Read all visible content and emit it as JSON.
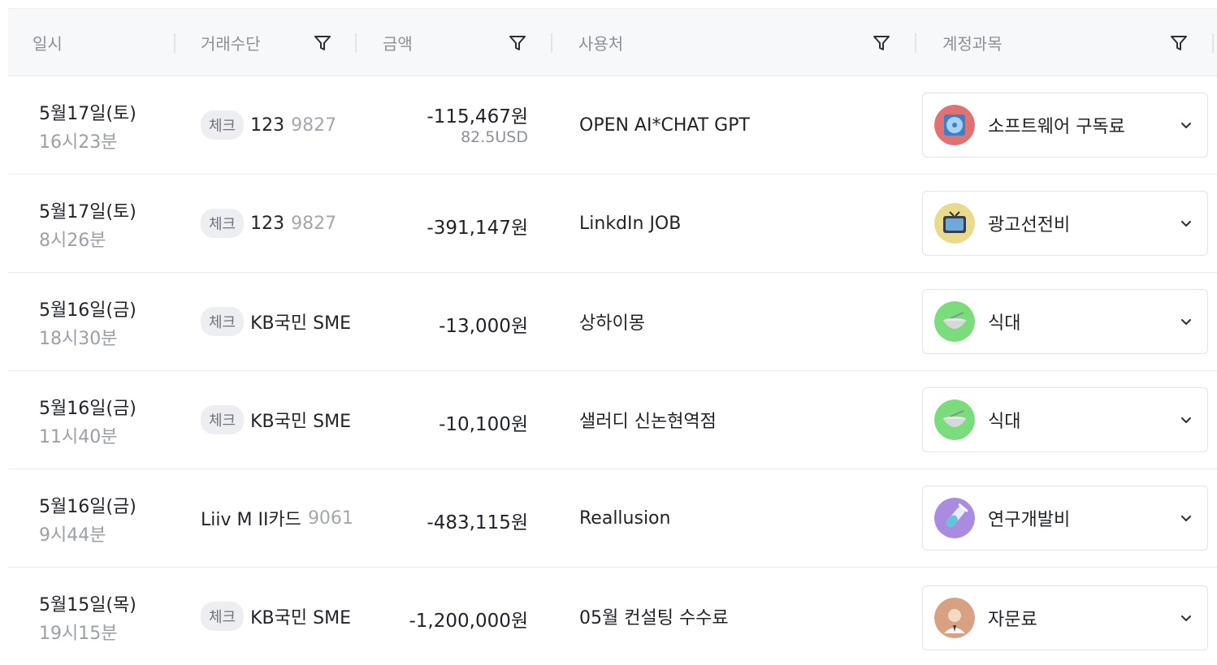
{
  "header": {
    "date": "일시",
    "method": "거래수단",
    "amount": "금액",
    "merchant": "사용처",
    "account": "계정과목"
  },
  "rows": [
    {
      "date": "5월17일(토)",
      "time": "16시23분",
      "chip": "체크",
      "card": "123",
      "cardnum": "9827",
      "amount": "-115,467원",
      "amount_sub": "82.5USD",
      "merchant": "OPEN AI*CHAT GPT",
      "account": "소프트웨어 구독료",
      "icon": "software-disc-icon",
      "icon_color": "#e07272"
    },
    {
      "date": "5월17일(토)",
      "time": "8시26분",
      "chip": "체크",
      "card": "123",
      "cardnum": "9827",
      "amount": "-391,147원",
      "merchant": "LinkdIn JOB",
      "account": "광고선전비",
      "icon": "tv-icon",
      "icon_color": "#e8dc8c"
    },
    {
      "date": "5월16일(금)",
      "time": "18시30분",
      "chip": "체크",
      "card": "KB국민 SME",
      "cardnum": "",
      "amount": "-13,000원",
      "merchant": "상하이몽",
      "account": "식대",
      "icon": "bowl-icon",
      "icon_color": "#7bdc7b"
    },
    {
      "date": "5월16일(금)",
      "time": "11시40분",
      "chip": "체크",
      "card": "KB국민 SME",
      "cardnum": "",
      "amount": "-10,100원",
      "merchant": "샐러디 신논현역점",
      "account": "식대",
      "icon": "bowl-icon",
      "icon_color": "#7bdc7b"
    },
    {
      "date": "5월16일(금)",
      "time": "9시44분",
      "chip": "",
      "card": "Liiv M II카드",
      "cardnum": "9061",
      "amount": "-483,115원",
      "merchant": "Reallusion",
      "account": "연구개발비",
      "icon": "test-tube-icon",
      "icon_color": "#a98be0"
    },
    {
      "date": "5월15일(목)",
      "time": "19시15분",
      "chip": "체크",
      "card": "KB국민 SME",
      "cardnum": "",
      "amount": "-1,200,000원",
      "merchant": "05월 컨설팅 수수료",
      "account": "자문료",
      "icon": "consultant-icon",
      "icon_color": "#d9a184"
    }
  ]
}
